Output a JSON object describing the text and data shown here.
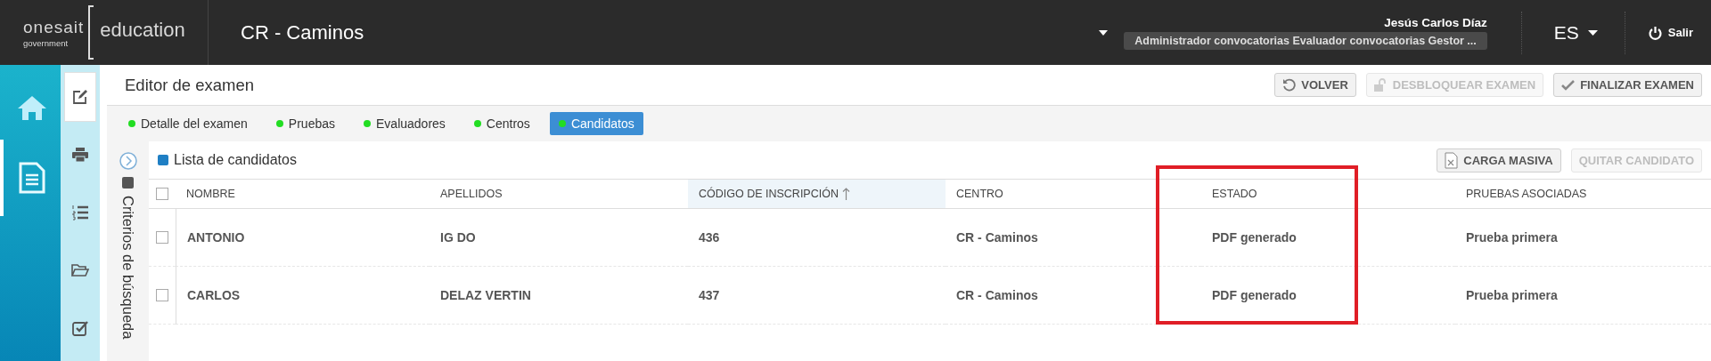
{
  "topbar": {
    "logo": {
      "brand": "onesait",
      "sub": "government",
      "product": "education"
    },
    "title": "CR - Caminos",
    "user": {
      "name": "Jesús Carlos Díaz",
      "roles": "Administrador convocatorias Evaluador convocatorias Gestor ..."
    },
    "language": "ES",
    "logout": "Salir"
  },
  "main_nav": [
    {
      "kind": "home",
      "selected": false
    },
    {
      "kind": "document",
      "selected": true
    }
  ],
  "sub_nav": [
    {
      "kind": "edit",
      "selected": true
    },
    {
      "kind": "print",
      "selected": false
    },
    {
      "kind": "list",
      "selected": false
    },
    {
      "kind": "folder",
      "selected": false
    },
    {
      "kind": "check",
      "selected": false
    }
  ],
  "editor": {
    "title": "Editor de examen",
    "actions": [
      {
        "label": "VOLVER",
        "disabled": false
      },
      {
        "label": "DESBLOQUEAR EXAMEN",
        "disabled": true
      },
      {
        "label": "FINALIZAR EXAMEN",
        "disabled": false
      }
    ],
    "tabs": [
      {
        "label": "Detalle del examen",
        "selected": false
      },
      {
        "label": "Pruebas",
        "selected": false
      },
      {
        "label": "Evaluadores",
        "selected": false
      },
      {
        "label": "Centros",
        "selected": false
      },
      {
        "label": "Candidatos",
        "selected": true
      }
    ],
    "filter_panel": {
      "label": "Criterios de búsqueda"
    },
    "list": {
      "title": "Lista de candidatos",
      "actions": [
        {
          "label": "CARGA MASIVA",
          "disabled": false
        },
        {
          "label": "QUITAR CANDIDATO",
          "disabled": true
        }
      ],
      "select_all": {
        "checked": false
      },
      "columns": [
        {
          "label": "NOMBRE",
          "sorted": false,
          "highlighted": false
        },
        {
          "label": "APELLIDOS",
          "sorted": false,
          "highlighted": false
        },
        {
          "label": "CÓDIGO DE INSCRIPCIÓN",
          "sorted": true,
          "highlighted": false
        },
        {
          "label": "CENTRO",
          "sorted": false,
          "highlighted": false
        },
        {
          "label": "ESTADO",
          "sorted": false,
          "highlighted": true
        },
        {
          "label": "PRUEBAS ASOCIADAS",
          "sorted": false,
          "highlighted": false
        }
      ],
      "rows": [
        {
          "checked": false,
          "cells": [
            "ANTONIO",
            "IG DO",
            "436",
            "CR - Caminos",
            "PDF generado",
            "Prueba primera"
          ]
        },
        {
          "checked": false,
          "cells": [
            "CARLOS",
            "DELAZ VERTIN",
            "437",
            "CR - Caminos",
            "PDF generado",
            "Prueba primera"
          ]
        }
      ]
    }
  }
}
